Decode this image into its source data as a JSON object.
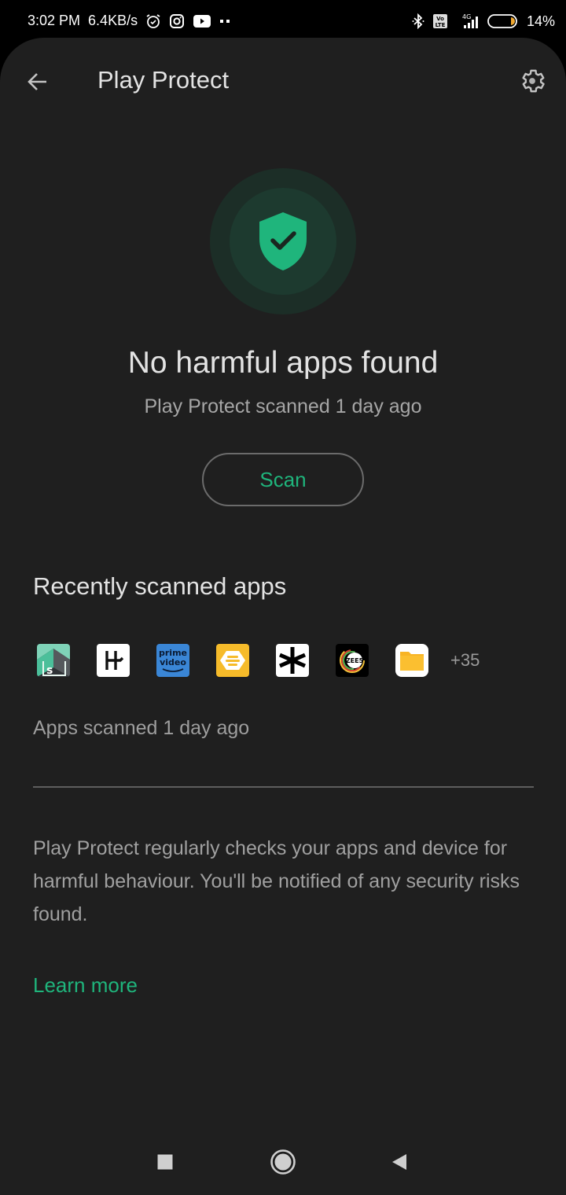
{
  "status_bar": {
    "time": "3:02 PM",
    "network_speed": "6.4KB/s",
    "notification_icons": [
      "alarm-icon",
      "instagram-icon",
      "youtube-icon",
      "more-dots-icon"
    ],
    "system_icons": [
      "bluetooth-icon",
      "volte-icon",
      "signal-4g-icon",
      "battery-icon"
    ],
    "network_type": "4G",
    "volte_label": "Vo LTE",
    "battery_percent": "14%",
    "battery_level": 0.14
  },
  "toolbar": {
    "back_icon": "arrow-left-icon",
    "title": "Play Protect",
    "settings_icon": "gear-icon"
  },
  "status": {
    "icon": "shield-check-icon",
    "headline": "No harmful apps found",
    "subline": "Play Protect scanned 1 day ago",
    "scan_button": "Scan"
  },
  "recent": {
    "title": "Recently scanned apps",
    "apps": [
      {
        "name": "Spaces app",
        "icon": "spaces-app-icon"
      },
      {
        "name": "Headway",
        "icon": "headway-app-icon"
      },
      {
        "name": "Prime Video",
        "icon": "prime-video-app-icon",
        "label_line1": "prime",
        "label_line2": "video"
      },
      {
        "name": "Bumble",
        "icon": "bumble-app-icon"
      },
      {
        "name": "Asterisk app",
        "icon": "asterisk-app-icon"
      },
      {
        "name": "ZEE5",
        "icon": "zee5-app-icon",
        "label": "ZEE5"
      },
      {
        "name": "Files",
        "icon": "files-app-icon"
      }
    ],
    "more_count": "+35",
    "scanned_text": "Apps scanned 1 day ago"
  },
  "info": {
    "description": "Play Protect regularly checks your apps and device for harmful behaviour. You'll be notified of any security risks found.",
    "learn_more": "Learn more"
  },
  "nav": {
    "recents": "recents-square-icon",
    "home": "home-circle-icon",
    "back": "back-triangle-icon"
  },
  "colors": {
    "accent_green": "#1fb57c",
    "background": "#1f1f1f",
    "status_bar": "#000000",
    "text_primary": "#e3e3e3",
    "text_secondary": "#a0a0a0"
  }
}
